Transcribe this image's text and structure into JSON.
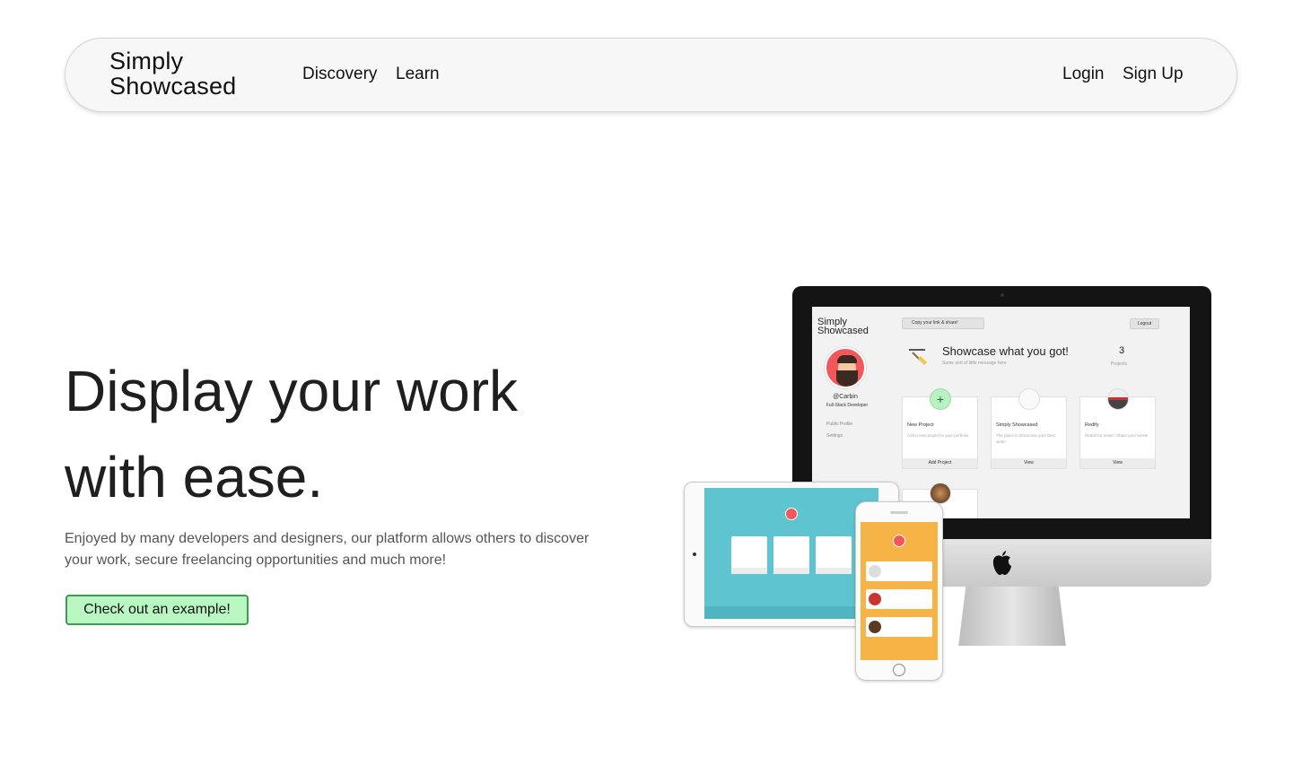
{
  "nav": {
    "logo_line1": "Simply",
    "logo_line2": "Showcased",
    "links": [
      "Discovery",
      "Learn"
    ],
    "login": "Login",
    "signup": "Sign Up"
  },
  "hero": {
    "title_line1": "Display your work",
    "title_line2": "with ease.",
    "subtitle": "Enjoyed by many developers and designers, our platform allows others to discover your work, secure freelancing opportunities and much more!",
    "cta": "Check out an example!"
  },
  "mockup": {
    "logo_line1": "Simply",
    "logo_line2": "Showcased",
    "copy_link": "Copy your link & share!",
    "logout": "Logout",
    "handle": "@Carbin",
    "role": "Full-Stack Developer",
    "side_items": [
      "Public Profile",
      "Settings"
    ],
    "headline": "Showcase what you got!",
    "subline": "Some sort of little message here",
    "count": "3",
    "count_label": "Projects",
    "cards": [
      {
        "title": "New Project",
        "desc": "Add a new project to your portfolio",
        "button": "Add Project"
      },
      {
        "title": "Simply Showcased",
        "desc": "The place to showcase your best work!",
        "button": "View"
      },
      {
        "title": "Redify",
        "desc": "Reddit for music! Share your tunes!",
        "button": "View"
      }
    ]
  },
  "colors": {
    "cta_bg": "#b9f7c2",
    "cta_border": "#3f9a52",
    "tablet_screen": "#5ec4cf",
    "phone_screen": "#f6b446",
    "avatar": "#f2575c"
  }
}
